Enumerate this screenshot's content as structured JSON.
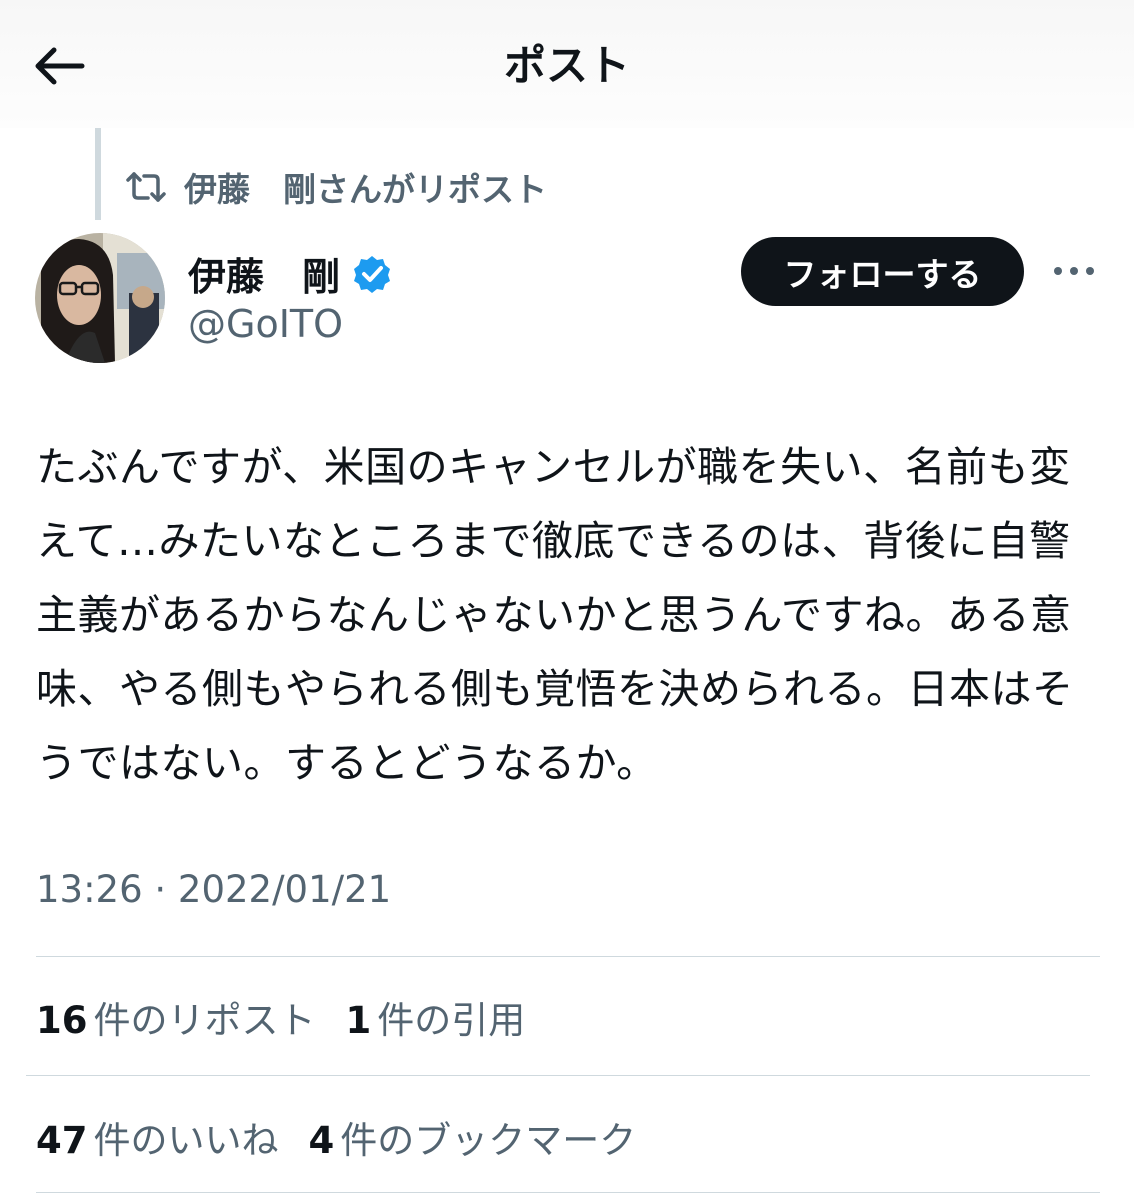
{
  "header": {
    "title": "ポスト",
    "back_icon": "arrow-left-icon"
  },
  "repost": {
    "icon": "repost-icon",
    "text": "伊藤　剛さんがリポスト"
  },
  "author": {
    "name": "伊藤　剛",
    "handle": "@GoITO",
    "verified": true,
    "verified_color": "#1d9bf0"
  },
  "follow_button": {
    "label": "フォローする"
  },
  "more_icon": "more-horizontal-icon",
  "post": {
    "text": "たぶんですが、米国のキャンセルが職を失い、名前も変えて…みたいなところまで徹底できるのは、背後に自警主義があるからなんじゃないかと思うんですね。ある意味、やる側もやられる側も覚悟を決められる。日本はそうではない。するとどうなるか。",
    "timestamp": "13:26 · 2022/01/21"
  },
  "stats": {
    "reposts": {
      "count": "16",
      "label": "件のリポスト"
    },
    "quotes": {
      "count": "1",
      "label": "件の引用"
    },
    "likes": {
      "count": "47",
      "label": "件のいいね"
    },
    "bookmarks": {
      "count": "4",
      "label": "件のブックマーク"
    }
  },
  "colors": {
    "text_primary": "#0f1419",
    "text_secondary": "#536471",
    "divider": "#cfd9de",
    "follow_bg": "#0f1419"
  }
}
